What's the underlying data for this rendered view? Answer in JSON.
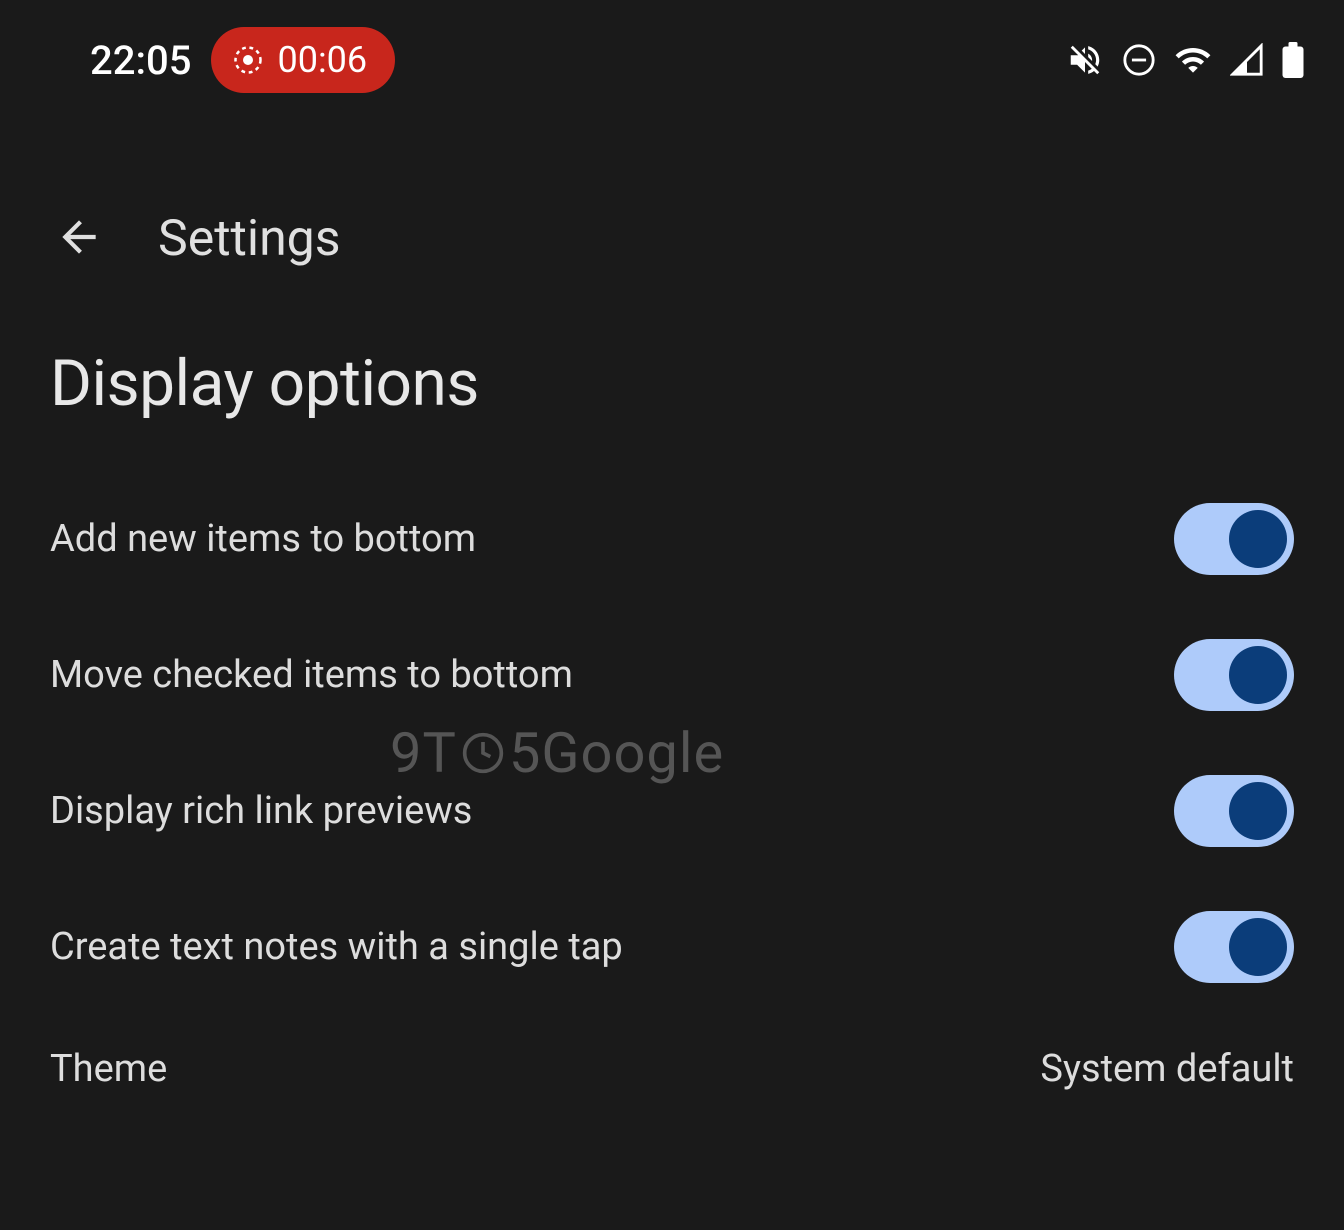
{
  "status_bar": {
    "clock": "22:05",
    "recording_time": "00:06"
  },
  "app_bar": {
    "title": "Settings"
  },
  "section": {
    "title": "Display options"
  },
  "settings": {
    "items": [
      {
        "label": "Add new items to bottom",
        "enabled": true
      },
      {
        "label": "Move checked items to bottom",
        "enabled": true
      },
      {
        "label": "Display rich link previews",
        "enabled": true
      },
      {
        "label": "Create text notes with a single tap",
        "enabled": true
      }
    ],
    "theme": {
      "label": "Theme",
      "value": "System default"
    }
  },
  "watermark": {
    "prefix": "9T",
    "suffix": "5Google"
  }
}
